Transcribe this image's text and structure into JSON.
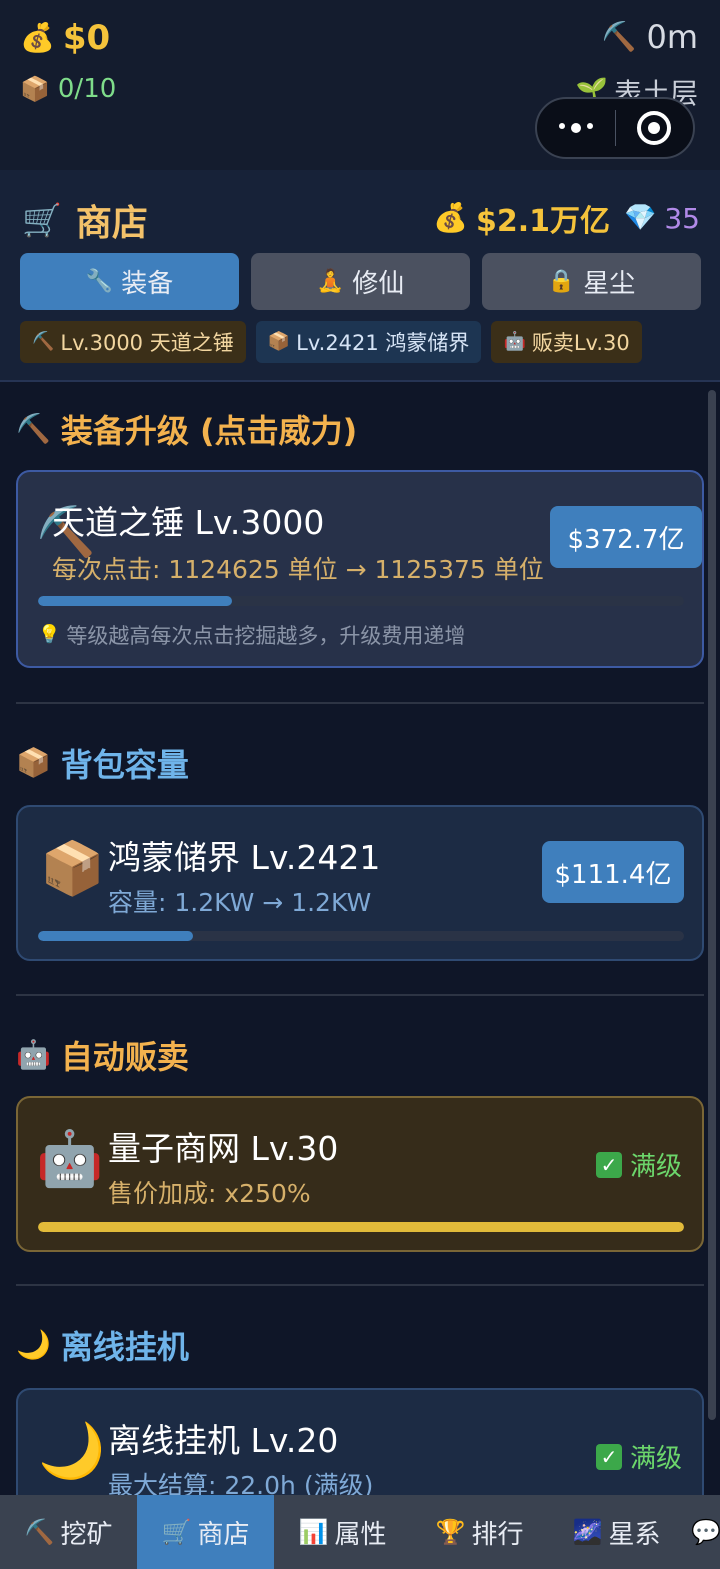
{
  "status": {
    "money": "$0",
    "money_icon": "💰",
    "bag": "0/10",
    "bag_icon": "📦",
    "depth": "0m",
    "depth_icon": "⛏️",
    "layer": "表土层",
    "layer_icon": "🌱"
  },
  "shop": {
    "icon": "🛒",
    "title": "商店",
    "money_icon": "💰",
    "balance": "$2.1万亿",
    "gem_icon": "💎",
    "gems": "35",
    "tabs": [
      {
        "icon": "🔧",
        "label": "装备",
        "active": true
      },
      {
        "icon": "🧘",
        "label": "修仙",
        "active": false
      },
      {
        "icon": "🔒",
        "label": "星尘",
        "active": false
      }
    ],
    "chips": [
      {
        "icon": "⛏️",
        "label": "Lv.3000 天道之锤"
      },
      {
        "icon": "📦",
        "label": "Lv.2421 鸿蒙储界"
      },
      {
        "icon": "🤖",
        "label": "贩卖Lv.30"
      }
    ]
  },
  "sections": {
    "equipment": {
      "icon": "⛏️",
      "title": "装备升级 (点击威力)",
      "item_icon": "⛏️",
      "name": "天道之锤 Lv.3000",
      "desc": "每次点击: 1124625 单位 → 1125375 单位",
      "price": "$372.7亿",
      "progress": 0.3,
      "tip_icon": "💡",
      "tip": "等级越高每次点击挖掘越多，升级费用递增"
    },
    "backpack": {
      "icon": "📦",
      "title": "背包容量",
      "item_icon": "📦",
      "name": "鸿蒙储界 Lv.2421",
      "desc": "容量: 1.2KW → 1.2KW",
      "price": "$111.4亿",
      "progress": 0.24
    },
    "autosell": {
      "icon": "🤖",
      "title": "自动贩卖",
      "item_icon": "🤖",
      "name": "量子商网 Lv.30",
      "desc": "售价加成: x250%",
      "status": "满级",
      "progress": 1.0
    },
    "offline": {
      "icon": "🌙",
      "title": "离线挂机",
      "item_icon": "🌙",
      "name": "离线挂机 Lv.20",
      "desc": "最大结算: 22.0h (满级)",
      "status": "满级"
    }
  },
  "nav": [
    {
      "icon": "⛏️",
      "label": "挖矿",
      "active": false
    },
    {
      "icon": "🛒",
      "label": "商店",
      "active": true
    },
    {
      "icon": "📊",
      "label": "属性",
      "active": false
    },
    {
      "icon": "🏆",
      "label": "排行",
      "active": false
    },
    {
      "icon": "🌌",
      "label": "星系",
      "active": false
    },
    {
      "icon": "💬",
      "label": "",
      "active": false
    }
  ],
  "colors": {
    "background": "#0f1628",
    "accent_blue": "#3f7fbd",
    "gold": "#f5c33b",
    "green": "#6cd66b",
    "purple": "#b18ae8"
  }
}
